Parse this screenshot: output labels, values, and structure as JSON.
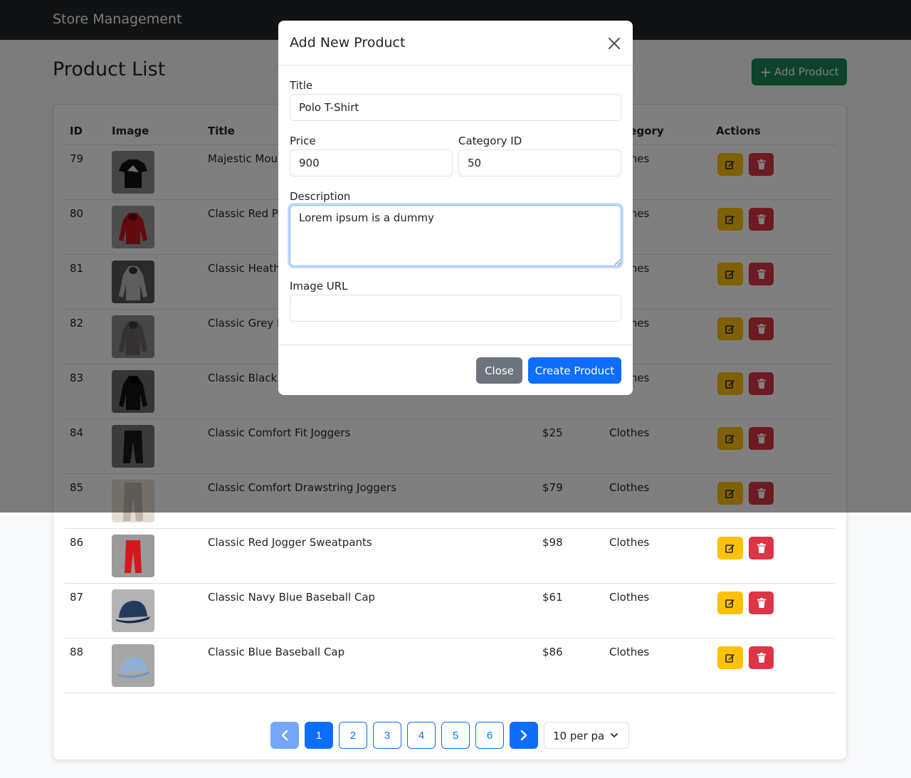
{
  "navbar": {
    "brand": "Store Management"
  },
  "page": {
    "title": "Product List",
    "add_button_label": "Add Product"
  },
  "table": {
    "headers": {
      "id": "ID",
      "image": "Image",
      "title": "Title",
      "category": "Category",
      "actions": "Actions"
    },
    "rows": [
      {
        "id": "79",
        "title": "Majestic Mountain Graphic T-Shirt",
        "price": "",
        "category": "Clothes",
        "image": "black-tshirt"
      },
      {
        "id": "80",
        "title": "Classic Red Pullover Hoodie",
        "price": "",
        "category": "Clothes",
        "image": "red-hoodie"
      },
      {
        "id": "81",
        "title": "Classic Heather Gray Hoodie",
        "price": "",
        "category": "Clothes",
        "image": "heather-hoodie"
      },
      {
        "id": "82",
        "title": "Classic Grey Hooded Sweatshirt",
        "price": "",
        "category": "Clothes",
        "image": "grey-hoodie"
      },
      {
        "id": "83",
        "title": "Classic Black Hooded Sweatshirt",
        "price": "",
        "category": "Clothes",
        "image": "black-hoodie"
      },
      {
        "id": "84",
        "title": "Classic Comfort Fit Joggers",
        "price": "$25",
        "category": "Clothes",
        "image": "black-joggers"
      },
      {
        "id": "85",
        "title": "Classic Comfort Drawstring Joggers",
        "price": "$79",
        "category": "Clothes",
        "image": "beige-joggers"
      },
      {
        "id": "86",
        "title": "Classic Red Jogger Sweatpants",
        "price": "$98",
        "category": "Clothes",
        "image": "red-sweatpants"
      },
      {
        "id": "87",
        "title": "Classic Navy Blue Baseball Cap",
        "price": "$61",
        "category": "Clothes",
        "image": "navy-cap"
      },
      {
        "id": "88",
        "title": "Classic Blue Baseball Cap",
        "price": "$86",
        "category": "Clothes",
        "image": "blue-cap"
      }
    ]
  },
  "pagination": {
    "pages": [
      "1",
      "2",
      "3",
      "4",
      "5",
      "6"
    ],
    "current": "1",
    "per_page": "10 per page"
  },
  "modal": {
    "title": "Add New Product",
    "fields": {
      "title_label": "Title",
      "title_value": "Polo T-Shirt",
      "price_label": "Price",
      "price_value": "900",
      "category_label": "Category ID",
      "category_value": "50",
      "description_label": "Description",
      "description_value": "Lorem ipsum is a dummy",
      "image_label": "Image URL",
      "image_value": ""
    },
    "close_label": "Close",
    "create_label": "Create Product"
  },
  "colors": {
    "primary": "#0d6efd",
    "success": "#198754",
    "warning": "#ffc107",
    "danger": "#dc3545",
    "secondary": "#6c757d",
    "navbar": "#212529"
  }
}
